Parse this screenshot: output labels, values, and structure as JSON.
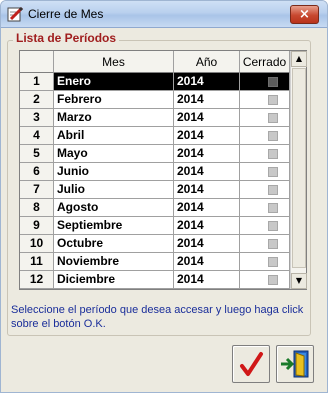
{
  "window": {
    "title": "Cierre de Mes",
    "close_glyph": "×"
  },
  "group": {
    "label": "Lista de Períodos"
  },
  "grid": {
    "columns": {
      "num": "",
      "mes": "Mes",
      "ano": "Año",
      "cerrado": "Cerrado"
    },
    "selected_row": 0,
    "rows": [
      {
        "num": "1",
        "mes": "Enero",
        "ano": "2014",
        "cerrado": false
      },
      {
        "num": "2",
        "mes": "Febrero",
        "ano": "2014",
        "cerrado": false
      },
      {
        "num": "3",
        "mes": "Marzo",
        "ano": "2014",
        "cerrado": false
      },
      {
        "num": "4",
        "mes": "Abril",
        "ano": "2014",
        "cerrado": false
      },
      {
        "num": "5",
        "mes": "Mayo",
        "ano": "2014",
        "cerrado": false
      },
      {
        "num": "6",
        "mes": "Junio",
        "ano": "2014",
        "cerrado": false
      },
      {
        "num": "7",
        "mes": "Julio",
        "ano": "2014",
        "cerrado": false
      },
      {
        "num": "8",
        "mes": "Agosto",
        "ano": "2014",
        "cerrado": false
      },
      {
        "num": "9",
        "mes": "Septiembre",
        "ano": "2014",
        "cerrado": false
      },
      {
        "num": "10",
        "mes": "Octubre",
        "ano": "2014",
        "cerrado": false
      },
      {
        "num": "11",
        "mes": "Noviembre",
        "ano": "2014",
        "cerrado": false
      },
      {
        "num": "12",
        "mes": "Diciembre",
        "ano": "2014",
        "cerrado": false
      }
    ]
  },
  "instructions": "Seleccione el período que desea accesar y luego haga click sobre el botón O.K.",
  "buttons": {
    "ok_icon": "checkmark-icon",
    "exit_icon": "exit-door-icon"
  },
  "colors": {
    "group_label": "#a01e1e",
    "instructions": "#1a2e9a",
    "checkmark": "#d01818"
  }
}
